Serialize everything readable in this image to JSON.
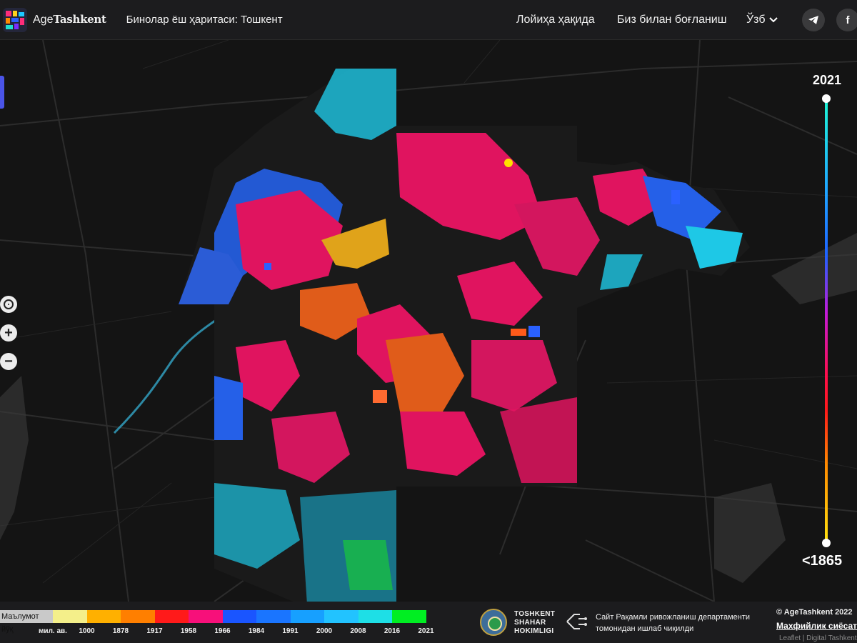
{
  "header": {
    "logo_prefix": "Age",
    "logo_bold": "Tashkent",
    "page_title": "Бинолар ёш ҳаритаси:",
    "city": "Тошкент",
    "nav": {
      "about": "Лойиҳа ҳақида",
      "contact": "Биз билан боғланиш",
      "language": "Ўзб"
    },
    "social": {
      "telegram_icon": "telegram-icon",
      "facebook_icon": "facebook-icon"
    }
  },
  "map_controls": {
    "locate_icon": "locate-icon",
    "zoom_in": "+",
    "zoom_out": "−"
  },
  "time_scale": {
    "max_label": "2021",
    "min_label": "<1865"
  },
  "legend": {
    "no_data_label": "Маълумот йўқ",
    "bins": [
      {
        "label": "мил. ав.",
        "color": "#f4ef8a"
      },
      {
        "label": "1000",
        "color": "#ffb000"
      },
      {
        "label": "1878",
        "color": "#ff7f00"
      },
      {
        "label": "1917",
        "color": "#ff1a1a"
      },
      {
        "label": "1958",
        "color": "#f7107a"
      },
      {
        "label": "1966",
        "color": "#1a55ff"
      },
      {
        "label": "1984",
        "color": "#1a75ff"
      },
      {
        "label": "1991",
        "color": "#17a0ff"
      },
      {
        "label": "2000",
        "color": "#22c3ff"
      },
      {
        "label": "2008",
        "color": "#1edfe6"
      },
      {
        "label": "2016",
        "color": "#00ee22"
      }
    ],
    "end_label": "2021"
  },
  "footer": {
    "hokimlik_line1": "TOSHKENT",
    "hokimlik_line2": "SHAHAR",
    "hokimlik_line3": "HOKIMLIGI",
    "dept_line1": "Сайт Рақамли ривожланиш департаменти",
    "dept_line2": "томонидан ишлаб чиқилди",
    "copyright": "© AgeTashkent 2022",
    "privacy": "Махфийлик сиёсати",
    "attribution": "Leaflet | Digital Tashkent"
  },
  "colors": {
    "header_bg": "#1c1c1e",
    "map_bg": "#141414",
    "accent": "#4a54e8"
  }
}
